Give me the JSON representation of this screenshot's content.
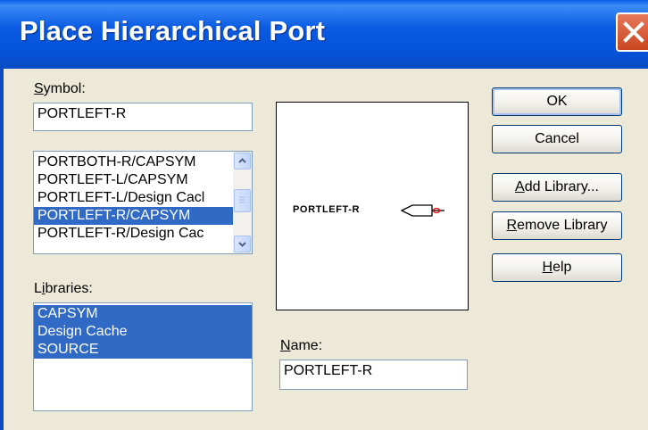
{
  "window": {
    "title": "Place Hierarchical Port"
  },
  "symbol": {
    "label_first": "S",
    "label_rest": "ymbol:",
    "value": "PORTLEFT-R"
  },
  "symbol_list": {
    "items": [
      {
        "label": "PORTBOTH-R/CAPSYM",
        "selected": false
      },
      {
        "label": "PORTLEFT-L/CAPSYM",
        "selected": false
      },
      {
        "label": "PORTLEFT-L/Design Cacl",
        "selected": false
      },
      {
        "label": "PORTLEFT-R/CAPSYM",
        "selected": true
      },
      {
        "label": "PORTLEFT-R/Design Cac",
        "selected": false
      }
    ]
  },
  "libraries": {
    "label_pre": "L",
    "label_ul": "i",
    "label_rest": "braries:",
    "items": [
      {
        "label": "CAPSYM",
        "selected": true
      },
      {
        "label": "Design Cache",
        "selected": true
      },
      {
        "label": "SOURCE",
        "selected": true
      }
    ]
  },
  "preview": {
    "port_text": "PORTLEFT-R",
    "accent": "#ff0000"
  },
  "name": {
    "label_first": "N",
    "label_rest": "ame:",
    "value": "PORTLEFT-R"
  },
  "buttons": {
    "ok": "OK",
    "cancel": "Cancel",
    "add_library_first": "A",
    "add_library_rest": "dd Library...",
    "remove_library_first": "R",
    "remove_library_rest": "emove Library",
    "help_first": "H",
    "help_rest": "elp"
  },
  "colors": {
    "title_bar": "#0a5ee8",
    "selection": "#316ac5",
    "dialog_bg": "#ece9d8"
  }
}
